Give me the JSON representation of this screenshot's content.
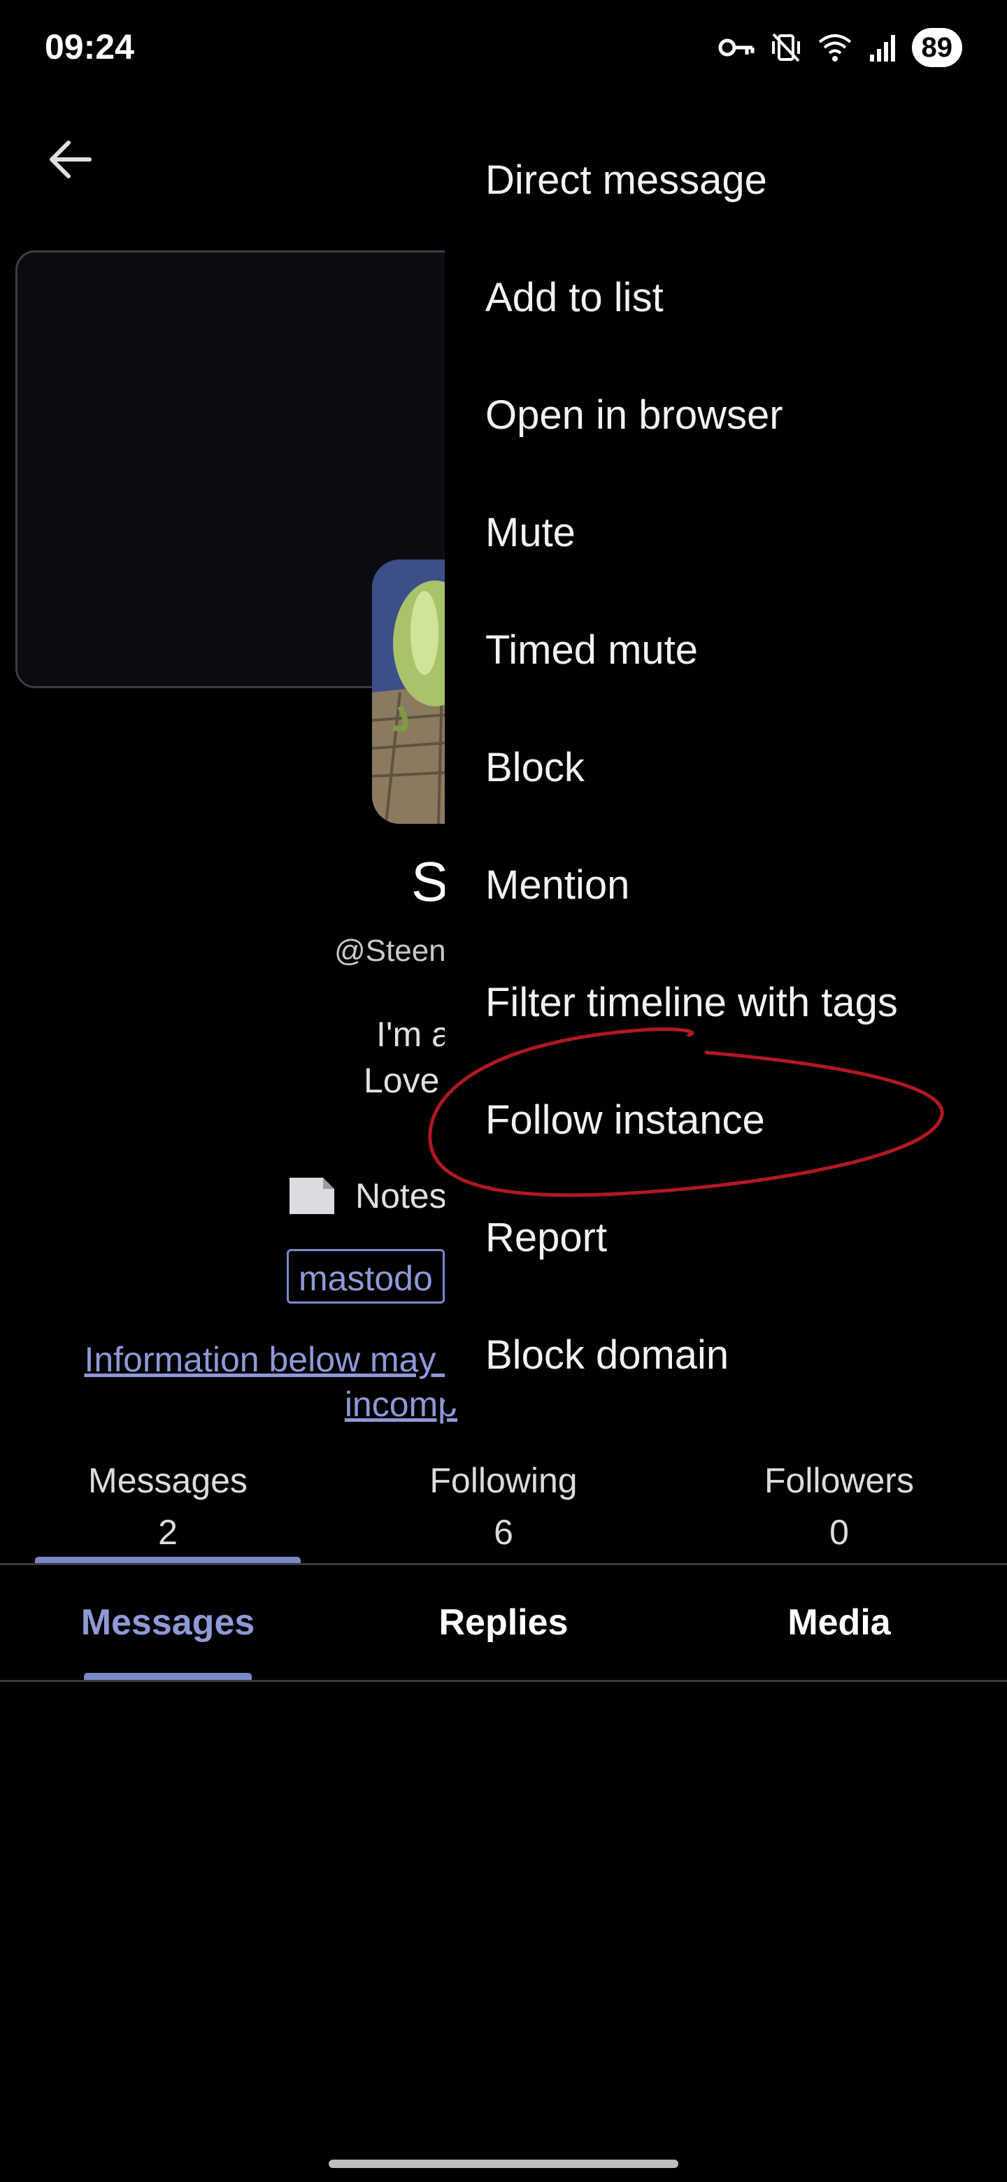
{
  "status_bar": {
    "time": "09:24",
    "icons": [
      "vpn-key-icon",
      "vibrate-off-icon",
      "wifi-icon",
      "signal-icon"
    ],
    "battery": "89"
  },
  "header": {
    "back_icon": "arrow-left-icon"
  },
  "profile": {
    "display_name_partial": "S",
    "handle_partial": "@Steen",
    "bio_line1_partial": "I'm a",
    "bio_line2_partial": "Love",
    "field_icon": "document-icon",
    "field_label_partial": "Notes",
    "instance_tag_partial": "mastodo",
    "info_link_line1": "Information below may r",
    "info_link_line2": "incomp"
  },
  "stats": [
    {
      "label": "Messages",
      "count": "2"
    },
    {
      "label": "Following",
      "count": "6"
    },
    {
      "label": "Followers",
      "count": "0"
    }
  ],
  "tabs": [
    {
      "label": "Messages",
      "active": true
    },
    {
      "label": "Replies",
      "active": false
    },
    {
      "label": "Media",
      "active": false
    }
  ],
  "menu": {
    "items": [
      "Direct message",
      "Add to list",
      "Open in browser",
      "Mute",
      "Timed mute",
      "Block",
      "Mention",
      "Filter timeline with tags",
      "Follow instance",
      "Report",
      "Block domain"
    ],
    "highlighted_item": "Follow instance"
  },
  "colors": {
    "background": "#000000",
    "accent": "#8f99d8",
    "annotation": "#b01822",
    "text": "#f2f2f5"
  }
}
